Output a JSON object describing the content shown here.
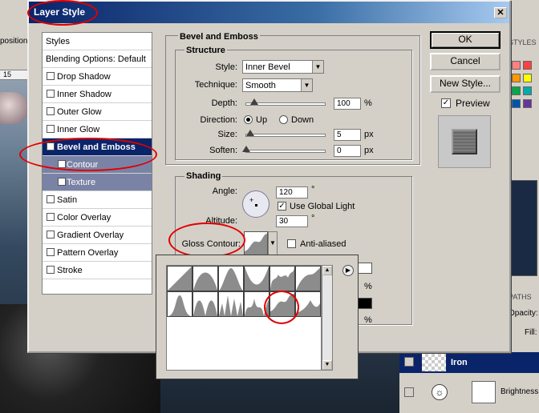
{
  "background": {
    "toolbar_label": "position",
    "ruler_value": "15",
    "styles_tab": "STYLES",
    "paths_tab": "PATHS",
    "opacity_label": "Opacity:",
    "fill_label": "Fill:",
    "layers": [
      {
        "name": "Iron"
      },
      {
        "name": "Brightness"
      }
    ]
  },
  "dialog": {
    "title": "Layer Style",
    "close": "✕",
    "styles_header": "Styles",
    "styles": [
      {
        "label": "Blending Options: Default",
        "checked": false,
        "header": true
      },
      {
        "label": "Drop Shadow",
        "checked": false
      },
      {
        "label": "Inner Shadow",
        "checked": false
      },
      {
        "label": "Outer Glow",
        "checked": false
      },
      {
        "label": "Inner Glow",
        "checked": false
      },
      {
        "label": "Bevel and Emboss",
        "checked": true,
        "selected": true
      },
      {
        "label": "Contour",
        "checked": false,
        "sub": true
      },
      {
        "label": "Texture",
        "checked": true,
        "sub": true
      },
      {
        "label": "Satin",
        "checked": false
      },
      {
        "label": "Color Overlay",
        "checked": false
      },
      {
        "label": "Gradient Overlay",
        "checked": false
      },
      {
        "label": "Pattern Overlay",
        "checked": false
      },
      {
        "label": "Stroke",
        "checked": false
      }
    ],
    "bevel": {
      "title": "Bevel and Emboss",
      "structure_title": "Structure",
      "style_label": "Style:",
      "style_value": "Inner Bevel",
      "technique_label": "Technique:",
      "technique_value": "Smooth",
      "depth_label": "Depth:",
      "depth_value": "100",
      "depth_unit": "%",
      "depth_level": 0.1,
      "direction_label": "Direction:",
      "dir_up": "Up",
      "dir_down": "Down",
      "size_label": "Size:",
      "size_value": "5",
      "size_unit": "px",
      "size_level": 0.05,
      "soften_label": "Soften:",
      "soften_value": "0",
      "soften_unit": "px",
      "soften_level": 0.0
    },
    "shading": {
      "title": "Shading",
      "angle_label": "Angle:",
      "angle_value": "120",
      "angle_unit": "°",
      "global_light_label": "Use Global Light",
      "altitude_label": "Altitude:",
      "altitude_value": "30",
      "altitude_unit": "°",
      "gloss_label": "Gloss Contour:",
      "antialiased_label": "Anti-aliased",
      "pct1": "%",
      "pct2": "%"
    },
    "buttons": {
      "ok": "OK",
      "cancel": "Cancel",
      "new_style": "New Style...",
      "preview": "Preview"
    }
  },
  "colors": {
    "selection": "#0a246a",
    "annotation_red": "#e00000",
    "dialog_face": "#d4d0c8"
  }
}
